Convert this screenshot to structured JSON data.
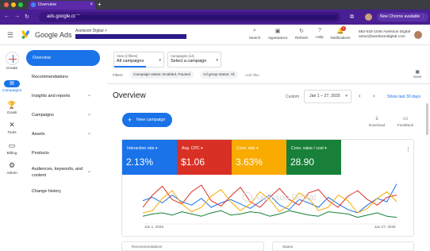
{
  "browser": {
    "tab_title": "Overview",
    "address": "ads.google.com",
    "new_chrome_label": "New Chrome available",
    "new_chrome_more": "⋮"
  },
  "header": {
    "brand": "Google Ads",
    "account_name": "Axelsson Digital",
    "account_chevron": ">",
    "buttons": [
      {
        "label": "Search",
        "icon": "⌕"
      },
      {
        "label": "Appearance",
        "icon": "▣"
      },
      {
        "label": "Refresh",
        "icon": "↻"
      },
      {
        "label": "Help",
        "icon": "?"
      },
      {
        "label": "Notifications",
        "icon": "🔔",
        "badge": "1"
      }
    ],
    "account_phone": "582-033-1046 Axelsson Digital",
    "account_email": "anton@axelssondigital.com",
    "more": "⋮"
  },
  "rail": {
    "create": "Create",
    "items": [
      {
        "label": "Campaigns",
        "icon": "▤"
      },
      {
        "label": "Goals",
        "icon": "🏆"
      },
      {
        "label": "Tools",
        "icon": "✕"
      },
      {
        "label": "Billing",
        "icon": "▭"
      },
      {
        "label": "Admin",
        "icon": "⚙"
      }
    ]
  },
  "nav": {
    "selected": "Overview",
    "items": [
      {
        "label": "Recommendations",
        "chevron": ""
      },
      {
        "label": "Insights and reports",
        "chevron": "⌄"
      },
      {
        "label": "Campaigns",
        "chevron": "⌄"
      },
      {
        "label": "Assets",
        "chevron": "⌄"
      },
      {
        "label": "Products",
        "chevron": ""
      },
      {
        "label": "Audiences, keywords, and",
        "label2": "content",
        "chevron": "⌄"
      },
      {
        "label": "Change history",
        "chevron": ""
      }
    ]
  },
  "filters": {
    "view_label": "View (2 filters)",
    "view_value": "All campaigns",
    "campaigns_label": "Campaigns (14)",
    "campaigns_value": "Select a campaign",
    "filters_label": "Filters",
    "chips": [
      "Campaign status: Enabled, Paused",
      "Ad group status: All"
    ],
    "add_filter": "Add filter",
    "save": "Save"
  },
  "overview": {
    "title": "Overview",
    "custom": "Custom",
    "date_range": "Jan 1 – 27, 2025",
    "show_last": "Show last 30 days",
    "new_campaign": "New campaign",
    "download": "Download",
    "feedback": "Feedback"
  },
  "metrics": [
    {
      "name": "Interaction rate ▾",
      "value": "2.13%",
      "color": "#1a73e8"
    },
    {
      "name": "Avg. CPC ▾",
      "value": "$1.06",
      "color": "#d93025"
    },
    {
      "name": "Conv. rate ▾",
      "value": "3.63%",
      "color": "#f9ab00"
    },
    {
      "name": "Conv. value / cost ▾",
      "value": "28.90",
      "color": "#188038"
    }
  ],
  "chart_data": {
    "type": "line",
    "x_start": "Jan 1, 2025",
    "x_end": "Jan 27, 2025",
    "watermark": "Axelsson Digital",
    "series": [
      {
        "color": "#1a73e8",
        "values": [
          42,
          48,
          38,
          52,
          40,
          34,
          46,
          30,
          38,
          44,
          36,
          28,
          40,
          52,
          34,
          26,
          44,
          38,
          30,
          48,
          36,
          26,
          20,
          34,
          46,
          40,
          72
        ]
      },
      {
        "color": "#d93025",
        "values": [
          30,
          52,
          68,
          44,
          36,
          58,
          70,
          42,
          32,
          50,
          66,
          40,
          30,
          48,
          64,
          44,
          34,
          56,
          62,
          42,
          30,
          50,
          60,
          44,
          34,
          48,
          52
        ]
      },
      {
        "color": "#f9ab00",
        "values": [
          20,
          24,
          46,
          60,
          36,
          22,
          30,
          50,
          62,
          40,
          24,
          36,
          58,
          44,
          22,
          34,
          56,
          46,
          24,
          30,
          52,
          42,
          20,
          28,
          46,
          58,
          40
        ]
      },
      {
        "color": "#188038",
        "values": [
          14,
          18,
          20,
          16,
          22,
          18,
          14,
          20,
          24,
          16,
          18,
          22,
          20,
          14,
          18,
          24,
          20,
          16,
          14,
          22,
          20,
          18,
          12,
          16,
          20,
          14,
          12
        ]
      }
    ],
    "ylim": [
      0,
      80
    ]
  },
  "bottom_cards": [
    "Recommendations",
    "Status"
  ]
}
